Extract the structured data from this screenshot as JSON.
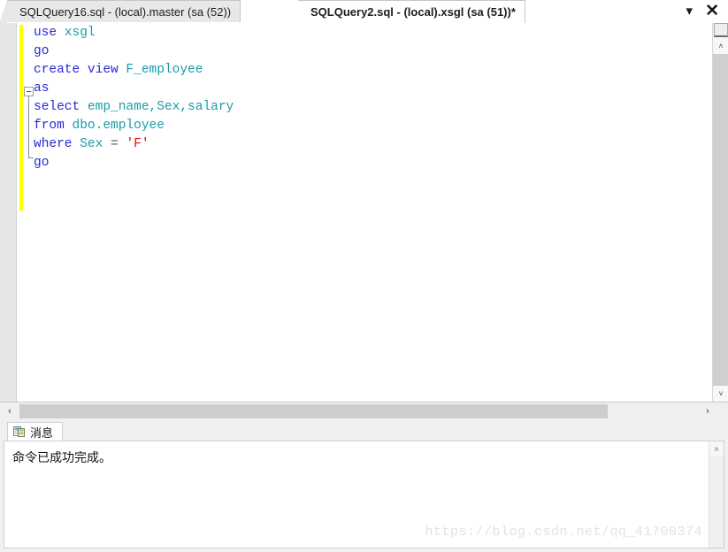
{
  "tabs": {
    "inactive": {
      "label": "SQLQuery16.sql - (local).master (sa (52))"
    },
    "active": {
      "label": "SQLQuery2.sql - (local).xsgl (sa (51))*"
    },
    "controls": {
      "dropdown_label": "▾",
      "close_label": "✕"
    }
  },
  "editor": {
    "lines": [
      {
        "tokens": [
          {
            "t": "use",
            "c": "kw"
          },
          {
            "t": " ",
            "c": "pln"
          },
          {
            "t": "xsgl",
            "c": "idn"
          }
        ]
      },
      {
        "tokens": [
          {
            "t": "go",
            "c": "kw"
          }
        ]
      },
      {
        "tokens": [
          {
            "t": "create view ",
            "c": "kw"
          },
          {
            "t": "F_employee",
            "c": "idn"
          }
        ]
      },
      {
        "tokens": [
          {
            "t": "as",
            "c": "kw"
          }
        ]
      },
      {
        "tokens": [
          {
            "t": "select ",
            "c": "kw"
          },
          {
            "t": "emp_name,Sex,salary",
            "c": "idn"
          }
        ]
      },
      {
        "tokens": [
          {
            "t": "from ",
            "c": "kw"
          },
          {
            "t": "dbo.employee",
            "c": "idn"
          }
        ]
      },
      {
        "tokens": [
          {
            "t": "where ",
            "c": "kw"
          },
          {
            "t": "Sex",
            "c": "idn"
          },
          {
            "t": " = ",
            "c": "op"
          },
          {
            "t": "'F'",
            "c": "str"
          }
        ]
      },
      {
        "tokens": [
          {
            "t": "go",
            "c": "kw"
          }
        ]
      }
    ],
    "plain_text": "use xsgl\ngo\ncreate view F_employee\nas\nselect emp_name,Sex,salary\nfrom dbo.employee\nwhere Sex = 'F'\ngo",
    "change_bar_color": "#ffff00",
    "outline_state": "expanded",
    "scrollbars": {
      "v_up_label": "˄",
      "v_down_label": "˅",
      "h_left_label": "‹",
      "h_right_label": "›"
    }
  },
  "results": {
    "tab_label": "消息",
    "message": "命令已成功完成。",
    "scroll_up_label": "˄"
  },
  "watermark": {
    "text": "https://blog.csdn.net/qq_41700374"
  },
  "colors": {
    "keyword": "#2828d8",
    "identifier": "#1a9ca8",
    "string": "#e01010",
    "change_bar": "#ffff00",
    "editor_background": "#ffffff",
    "chrome_background": "#f0f0f0"
  }
}
